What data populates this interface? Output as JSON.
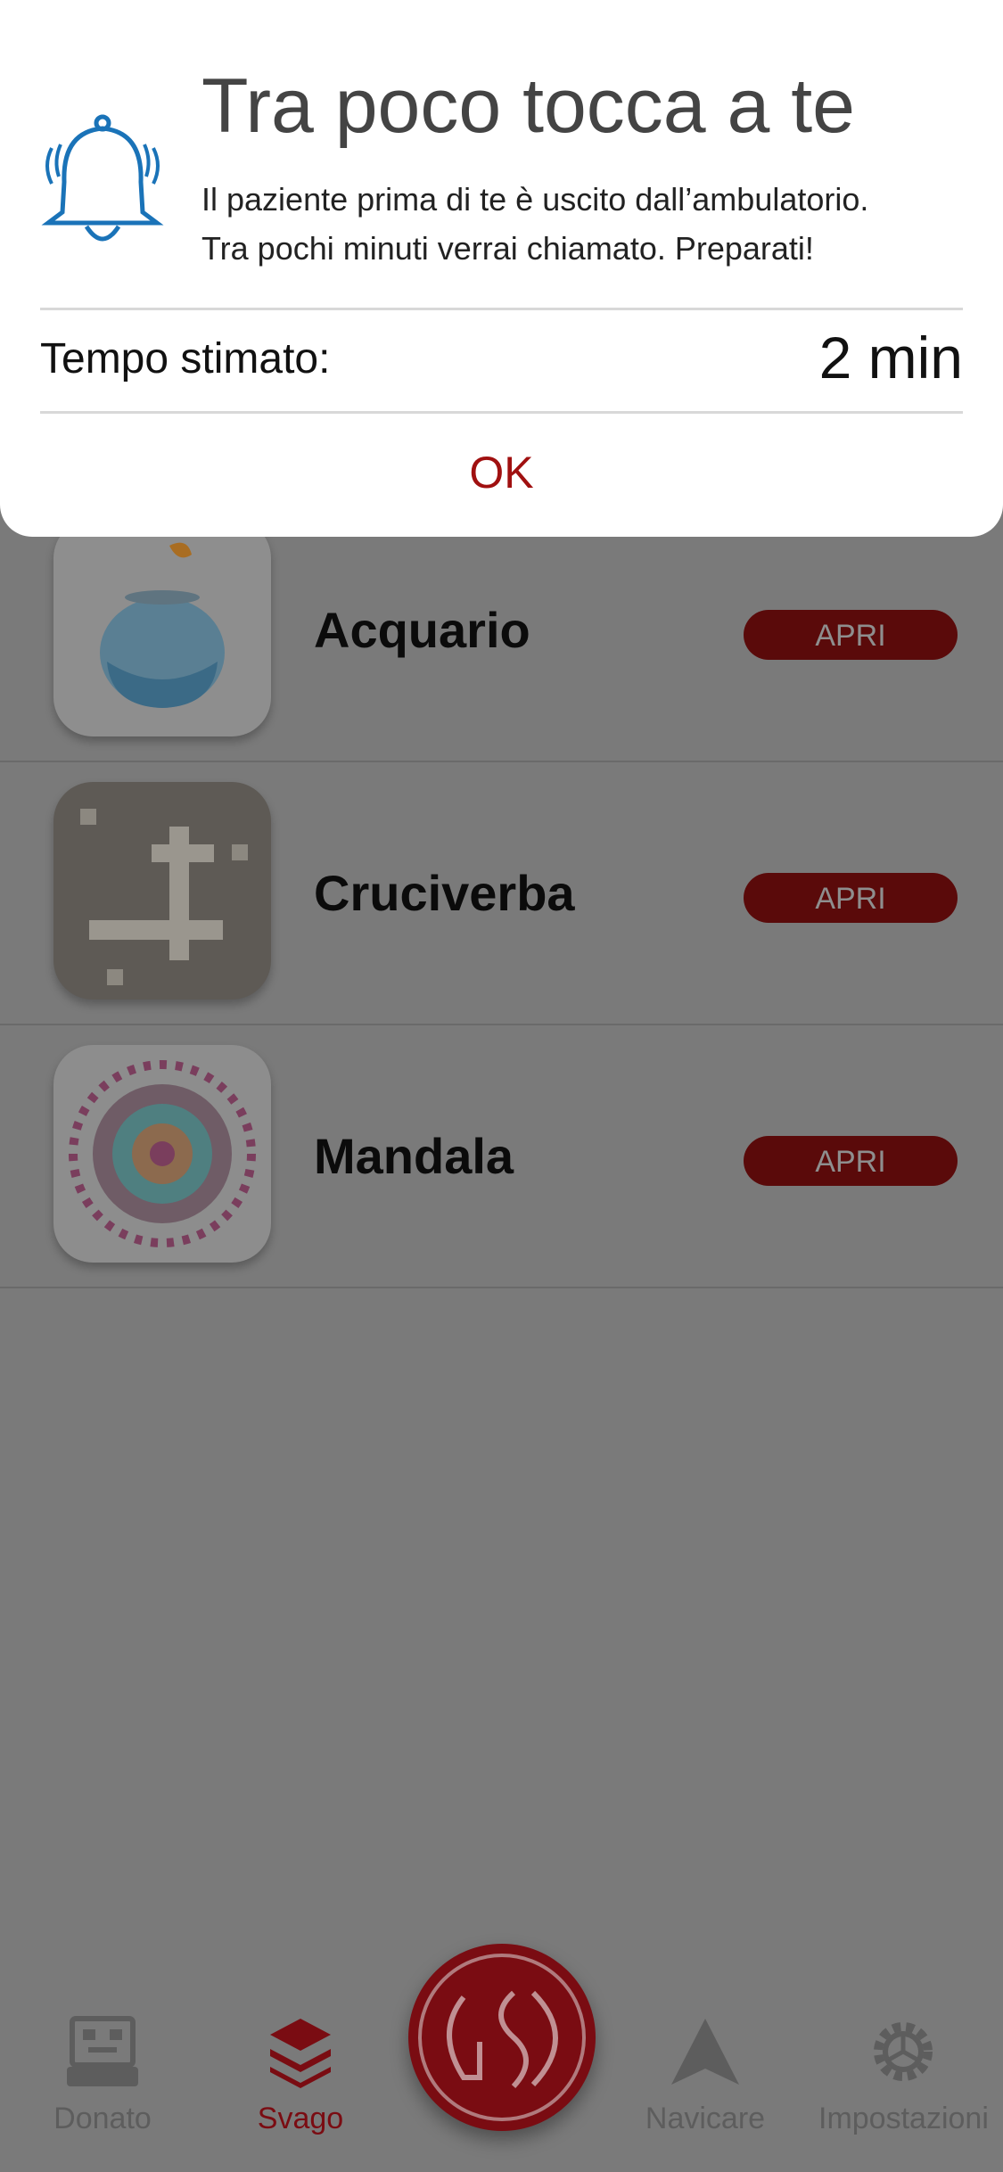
{
  "alert": {
    "title": "Tra poco tocca a te",
    "message_line1": "Il paziente prima di te è uscito dall’ambulatorio.",
    "message_line2": "Tra pochi minuti verrai chiamato. Preparati!",
    "estimate_label": "Tempo stimato:",
    "estimate_value": "2 min",
    "ok_label": "OK",
    "icon": "bell-icon",
    "accent_color": "#1a73b8"
  },
  "items": [
    {
      "title": "Acquario",
      "button": "APRI",
      "icon": "fishbowl-image"
    },
    {
      "title": "Cruciverba",
      "button": "APRI",
      "icon": "crossword-tiles-image"
    },
    {
      "title": "Mandala",
      "button": "APRI",
      "icon": "mandala-image"
    }
  ],
  "tabbar": {
    "tabs": [
      {
        "label": "Donato",
        "icon": "robot-icon"
      },
      {
        "label": "Svago",
        "icon": "layers-icon",
        "active": true
      },
      {
        "label": "Navicare",
        "icon": "navigation-arrow-icon"
      },
      {
        "label": "Impostazioni",
        "icon": "gear-icon"
      }
    ],
    "center_logo": "GSD",
    "active_color": "#7a0c12"
  }
}
